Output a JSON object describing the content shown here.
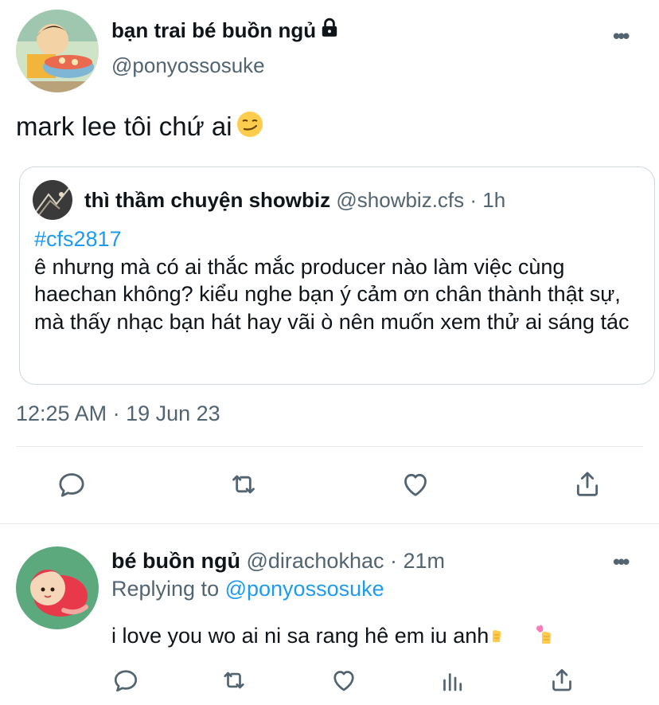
{
  "main_tweet": {
    "display_name": "bạn trai bé buồn ngủ",
    "handle": "@ponyossosuke",
    "text": "mark lee tôi chứ ai",
    "timestamp": "12:25 AM · 19 Jun 23",
    "more_label": "•••"
  },
  "quoted_tweet": {
    "display_name": "thì thầm chuyện showbiz",
    "handle": "@showbiz.cfs",
    "separator": " · ",
    "time": "1h",
    "hashtag": "#cfs2817",
    "text": "ê nhưng mà có ai thắc mắc producer nào làm việc cùng haechan không? kiểu nghe bạn ý cảm ơn chân thành thật sự, mà thấy nhạc bạn hát hay vãi ò nên muốn xem thử ai sáng tác"
  },
  "reply": {
    "display_name": "bé buồn ngủ",
    "handle": "@dirachokhac",
    "separator": " · ",
    "time": "21m",
    "replying_prefix": "Replying to ",
    "replying_to": "@ponyossosuke",
    "text": "i love you wo ai ni sa rang hê em iu anh",
    "more_label": "•••"
  },
  "icons": {
    "action_bar_main": [
      "reply-icon",
      "retweet-icon",
      "like-icon",
      "share-icon"
    ],
    "action_bar_reply": [
      "reply-icon",
      "retweet-icon",
      "like-icon",
      "views-icon",
      "share-icon"
    ],
    "lock": "lock-icon",
    "emoji_main": "smirking-face-emoji",
    "emoji_reply": [
      "finger-emoji",
      "kiss-emoji"
    ]
  },
  "colors": {
    "accent": "#1d9bf0",
    "secondary_text": "#536471",
    "border": "#cfd9de"
  }
}
